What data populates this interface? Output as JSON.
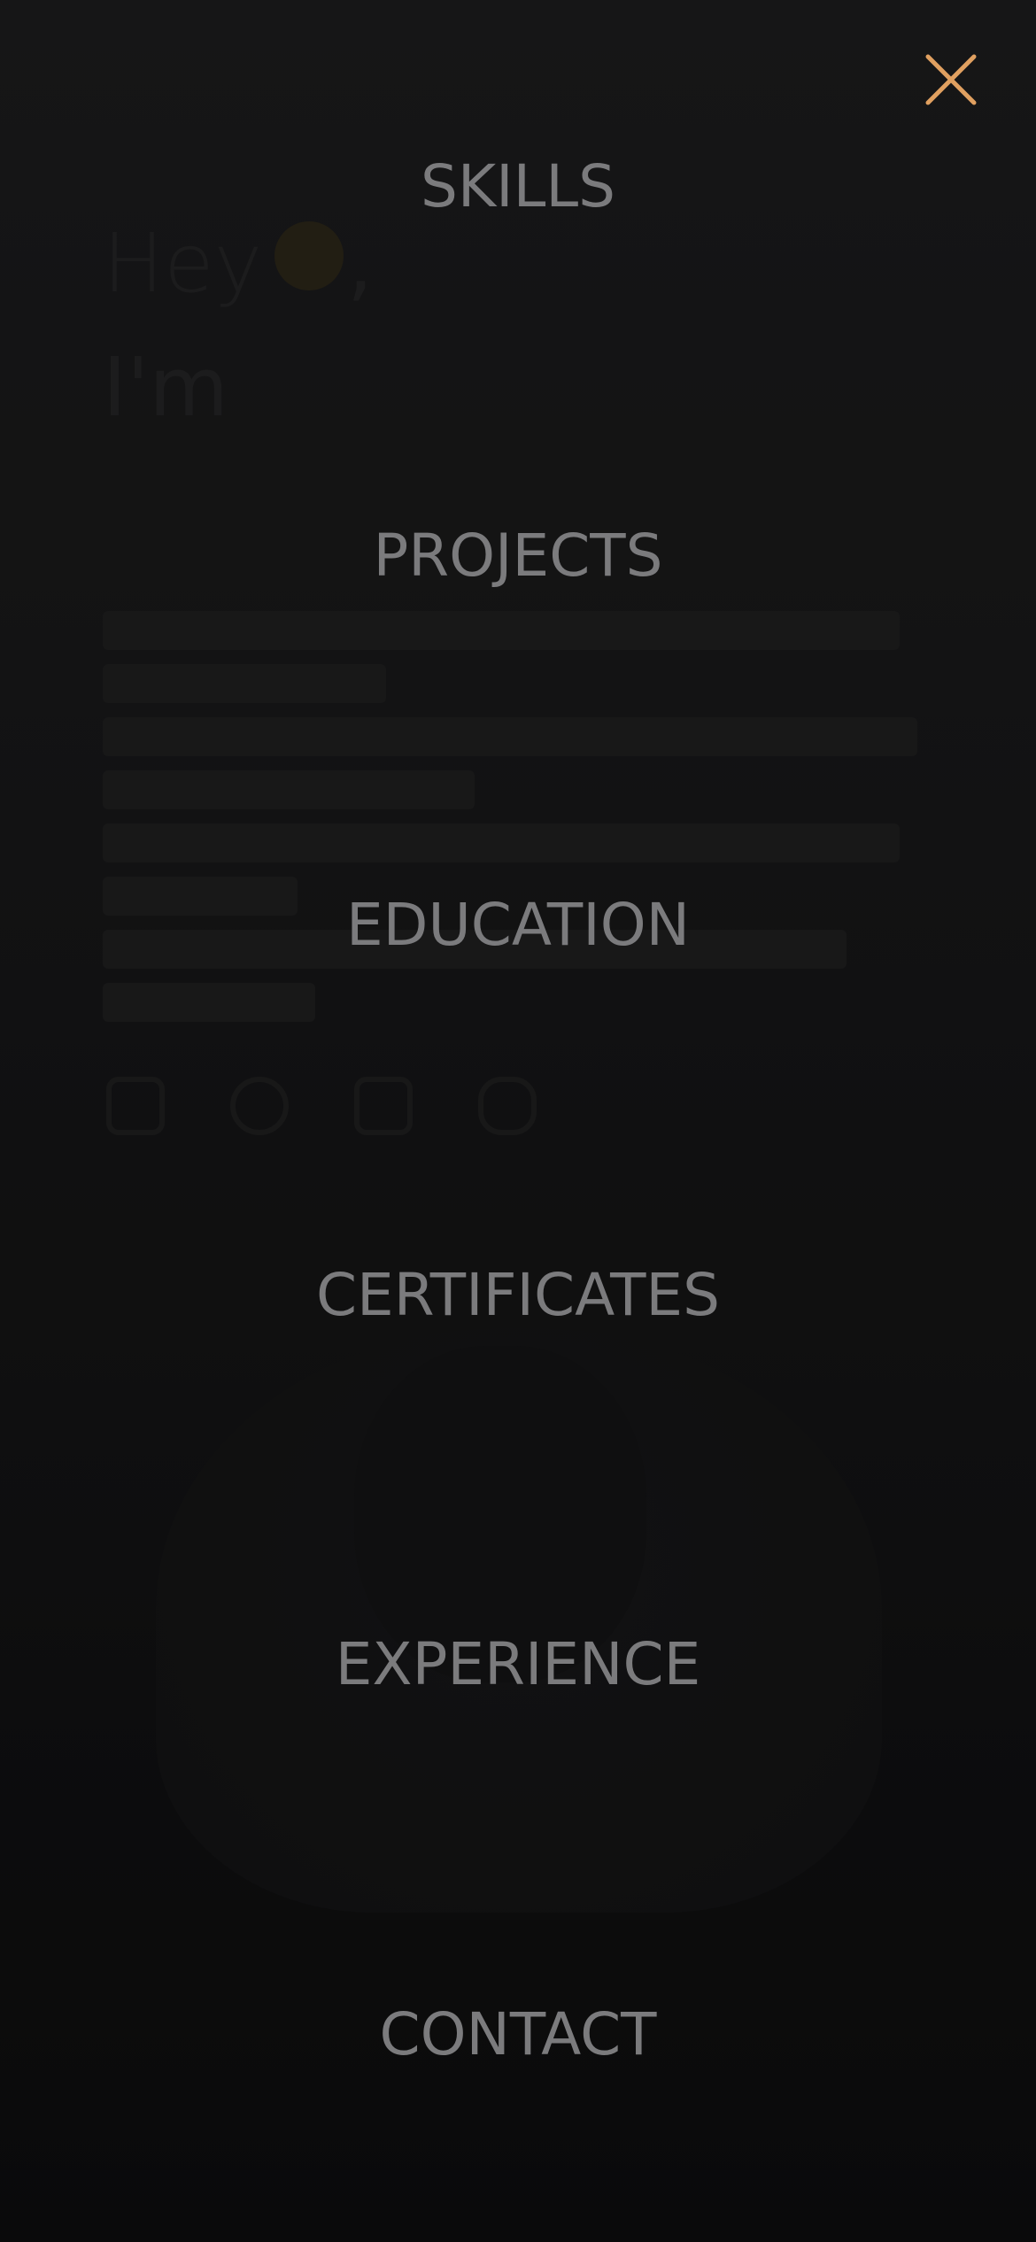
{
  "background_page": {
    "hey_text": "Hey",
    "hey_comma": ",",
    "im_text": "I'm"
  },
  "menu": {
    "close_icon": "close-icon",
    "accent_color": "#e0a060",
    "text_color": "#7b7b7d",
    "items": [
      {
        "label": "SKILLS"
      },
      {
        "label": "PROJECTS"
      },
      {
        "label": "EDUCATION"
      },
      {
        "label": "CERTIFICATES"
      },
      {
        "label": "EXPERIENCE"
      },
      {
        "label": "CONTACT"
      }
    ]
  }
}
